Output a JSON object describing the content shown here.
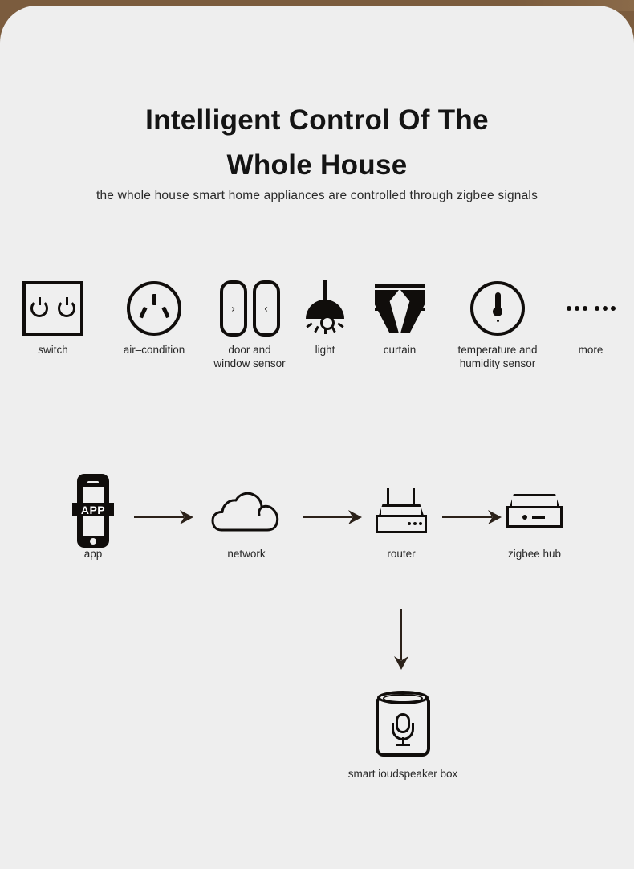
{
  "theme": {
    "banner_color": "#7b5c3e",
    "panel_background": "#eeeeee",
    "ink_color": "#100d0b",
    "arrow_color": "#2b2119"
  },
  "heading": {
    "title_line1": "Intelligent  Control  Of The",
    "title_line2": "Whole  House",
    "subtitle": "the whole  house  smart home  appliances  are  controlled  through  zigbee  signals"
  },
  "devices": [
    {
      "icon": "switch-icon",
      "label": "switch"
    },
    {
      "icon": "power-socket-icon",
      "label": "air–condition"
    },
    {
      "icon": "door-window-sensor-icon",
      "label": "door and\nwindow  sensor"
    },
    {
      "icon": "pendant-light-icon",
      "label": "light"
    },
    {
      "icon": "curtain-icon",
      "label": "curtain"
    },
    {
      "icon": "thermometer-icon",
      "label": "temperature and\nhumidity sensor"
    },
    {
      "icon": "more-dots-icon",
      "label": "more"
    }
  ],
  "flow": {
    "nodes": [
      {
        "icon": "phone-icon",
        "label": "app",
        "screen_text": "APP"
      },
      {
        "icon": "cloud-icon",
        "label": "network"
      },
      {
        "icon": "router-icon",
        "label": "router"
      },
      {
        "icon": "zigbee-hub-icon",
        "label": "zigbee hub"
      }
    ],
    "speaker": {
      "icon": "smart-speaker-icon",
      "label": "smart  ioudspeaker box"
    }
  }
}
